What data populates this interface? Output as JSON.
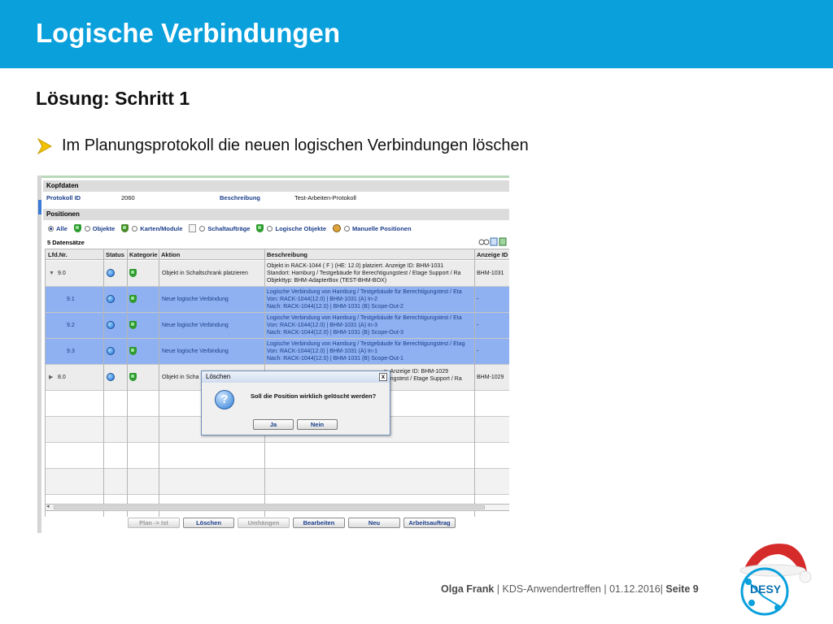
{
  "slide": {
    "title": "Logische Verbindungen",
    "subtitle": "Lösung: Schritt 1",
    "bullet": "Im Planungsprotokoll die neuen logischen Verbindungen löschen"
  },
  "screenshot": {
    "kopfdaten": {
      "header": "Kopfdaten",
      "protokoll_id_label": "Protokoll ID",
      "protokoll_id_value": "2060",
      "beschreibung_label": "Beschreibung",
      "beschreibung_value": "Test-Arbeiten-Protokoll"
    },
    "positionen": {
      "header": "Positionen",
      "filters": [
        "Alle",
        "Objekte",
        "Karten/Module",
        "Schaltaufträge",
        "Logische Objekte",
        "Manuelle Positionen"
      ],
      "selected_filter": "Alle",
      "count_text": "5 Datensätze"
    },
    "grid": {
      "columns": [
        "Lfd.Nr.",
        "Status",
        "Kategorie",
        "Aktion",
        "Beschreibung",
        "Anzeige ID"
      ],
      "rows": [
        {
          "nr": "9.0",
          "expander": "▼",
          "aktion": "Objekt in Schaltschrank platzieren",
          "beschreibung": [
            "Objekt in RACK-1044 ( F ) (HE: 12.0) platziert. Anzeige ID: BHM-1031",
            "Standort: Hamburg / Testgebäude für Berechtigungstest / Etage Support / Ra",
            "Objekttyp: BHM-AdapterBox (TEST-BHM-BOX)"
          ],
          "anzeige_id": "BHM-1031"
        },
        {
          "nr": "9.1",
          "expander": "",
          "aktion": "Neue logische Verbindung",
          "beschreibung": [
            "Logische Verbindung von Hamburg / Testgebäude für Berechtigungstest / Eta",
            "Von: RACK-1044(12.0) | BHM-1031 (A) In-2",
            "Nach: RACK-1044(12.0) | BHM-1031 (B) Scope-Out-2"
          ],
          "anzeige_id": "-"
        },
        {
          "nr": "9.2",
          "expander": "",
          "aktion": "Neue logische Verbindung",
          "beschreibung": [
            "Logische Verbindung von Hamburg / Testgebäude für Berechtigungstest / Eta",
            "Von: RACK-1044(12.0) | BHM-1031 (A) In-3",
            "Nach: RACK-1044(12.0) | BHM-1031 (B) Scope-Out-3"
          ],
          "anzeige_id": "-"
        },
        {
          "nr": "9.3",
          "expander": "",
          "aktion": "Neue logische Verbindung",
          "beschreibung": [
            "Logische Verbindung von Hamburg / Testgebäude für Berechtigungstest / Etag",
            "Von: RACK-1044(12.0) | BHM-1031 (A) In-1",
            "Nach: RACK-1044(12.0) | BHM-1031 (B) Scope-Out-1"
          ],
          "anzeige_id": "-"
        },
        {
          "nr": "8.0",
          "expander": "▶",
          "aktion": "Objekt in Scha",
          "beschreibung": [
            "n. Anzeige ID: BHM-1029",
            "gungstest / Etage Support / Ra",
            ""
          ],
          "anzeige_id": "BHM-1029"
        }
      ]
    },
    "buttons": [
      {
        "label": "Plan -> Ist",
        "enabled": false
      },
      {
        "label": "Löschen",
        "enabled": true
      },
      {
        "label": "Umhängen",
        "enabled": false
      },
      {
        "label": "Bearbeiten",
        "enabled": true
      },
      {
        "label": "Neu",
        "enabled": true
      },
      {
        "label": "Arbeitsauftrag",
        "enabled": true
      }
    ],
    "dialog": {
      "title": "Löschen",
      "close_symbol": "x",
      "message": "Soll die Position wirklich gelöscht werden?",
      "yes_label": "Ja",
      "no_label": "Nein"
    }
  },
  "footer": {
    "author": "Olga Frank",
    "event": "KDS-Anwendertreffen",
    "date": "01.12.2016",
    "page_label": "Seite 9",
    "logo_text": "DESY"
  },
  "colors": {
    "title_bar": "#0aa0dc",
    "selected_row": "#8fb1f1",
    "link": "#1b3e8a"
  }
}
